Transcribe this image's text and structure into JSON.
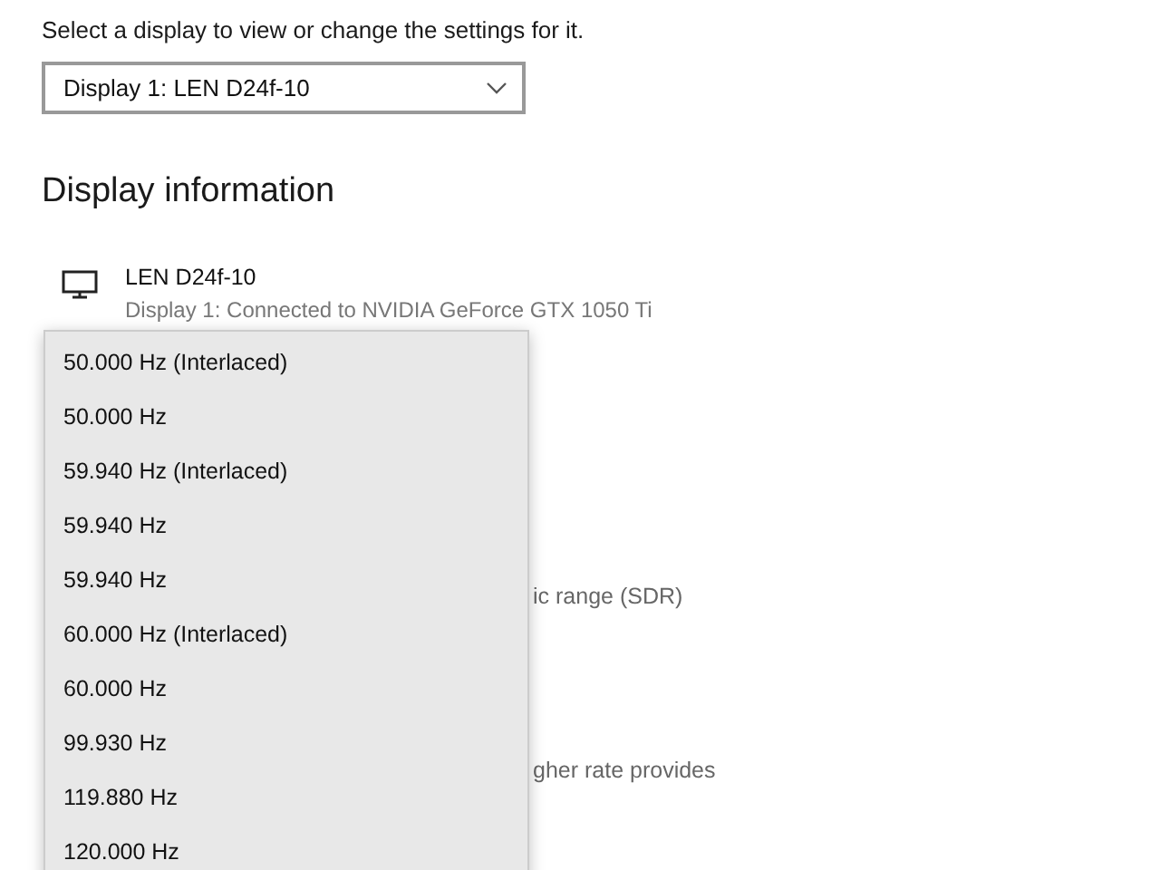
{
  "display_select": {
    "label": "Select a display to view or change the settings for it.",
    "value": "Display 1: LEN D24f-10"
  },
  "display_information": {
    "heading": "Display information",
    "monitor_name": "LEN D24f-10",
    "monitor_detail": "Display 1: Connected to NVIDIA GeForce GTX 1050 Ti",
    "partial_texts": [
      "ic range (SDR)",
      "gher rate provides"
    ]
  },
  "refresh_rate_menu": {
    "items": [
      "50.000 Hz (Interlaced)",
      "50.000 Hz",
      "59.940 Hz (Interlaced)",
      "59.940 Hz",
      "59.940 Hz",
      "60.000 Hz (Interlaced)",
      "60.000 Hz",
      "99.930 Hz",
      "119.880 Hz",
      "120.000 Hz"
    ]
  }
}
